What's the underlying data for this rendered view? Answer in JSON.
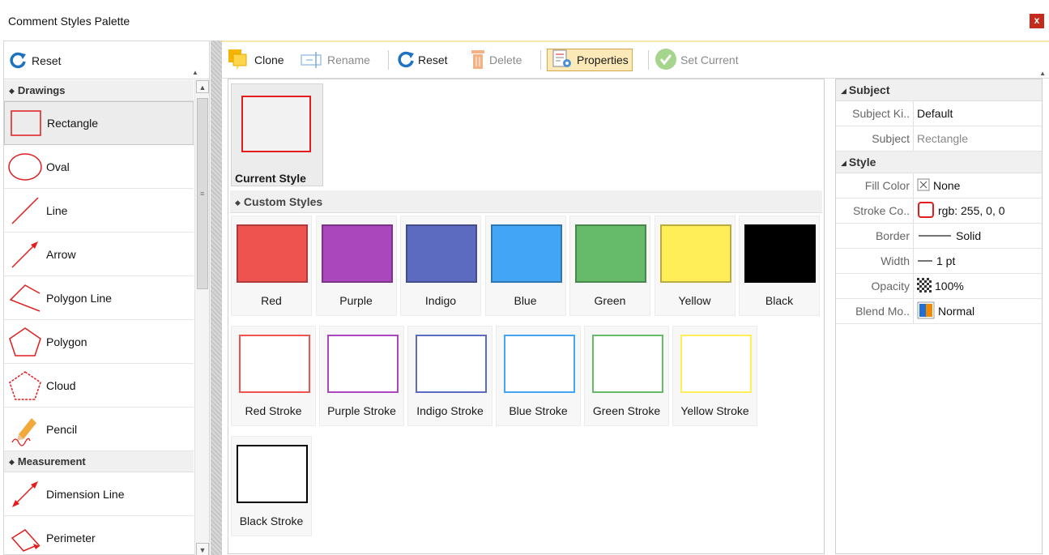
{
  "window": {
    "title": "Comment Styles Palette",
    "close_label": "x"
  },
  "left_panel": {
    "reset_label": "Reset",
    "groups": [
      {
        "label": "Drawings",
        "items": [
          "Rectangle",
          "Oval",
          "Line",
          "Arrow",
          "Polygon Line",
          "Polygon",
          "Cloud",
          "Pencil"
        ]
      },
      {
        "label": "Measurement",
        "items": [
          "Dimension Line",
          "Perimeter"
        ]
      }
    ],
    "selected_item": "Rectangle"
  },
  "toolbar": {
    "clone": "Clone",
    "rename": "Rename",
    "reset": "Reset",
    "delete": "Delete",
    "properties": "Properties",
    "set_current": "Set Current"
  },
  "styles": {
    "current_label": "Current Style",
    "custom_header": "Custom Styles",
    "filled": [
      {
        "name": "Red",
        "color": "#ef5350"
      },
      {
        "name": "Purple",
        "color": "#ab47bc"
      },
      {
        "name": "Indigo",
        "color": "#5c6bc0"
      },
      {
        "name": "Blue",
        "color": "#42a5f5"
      },
      {
        "name": "Green",
        "color": "#66bb6a"
      },
      {
        "name": "Yellow",
        "color": "#ffee58"
      },
      {
        "name": "Black",
        "color": "#000000"
      }
    ],
    "stroked": [
      {
        "name": "Red Stroke",
        "color": "#ef5350"
      },
      {
        "name": "Purple Stroke",
        "color": "#ab47bc"
      },
      {
        "name": "Indigo Stroke",
        "color": "#5c6bc0"
      },
      {
        "name": "Blue Stroke",
        "color": "#42a5f5"
      },
      {
        "name": "Green Stroke",
        "color": "#66bb6a"
      },
      {
        "name": "Yellow Stroke",
        "color": "#ffee58"
      },
      {
        "name": "Black Stroke",
        "color": "#000000"
      }
    ]
  },
  "properties": {
    "subject_group": "Subject",
    "subject_kind_label": "Subject Ki..",
    "subject_kind_value": "Default",
    "subject_label": "Subject",
    "subject_value": "Rectangle",
    "style_group": "Style",
    "fill_label": "Fill Color",
    "fill_value": "None",
    "stroke_label": "Stroke Co..",
    "stroke_value": "rgb: 255, 0, 0",
    "border_label": "Border",
    "border_value": "Solid",
    "width_label": "Width",
    "width_value": "1 pt",
    "opacity_label": "Opacity",
    "opacity_value": "100%",
    "blend_label": "Blend Mo..",
    "blend_value": "Normal"
  }
}
